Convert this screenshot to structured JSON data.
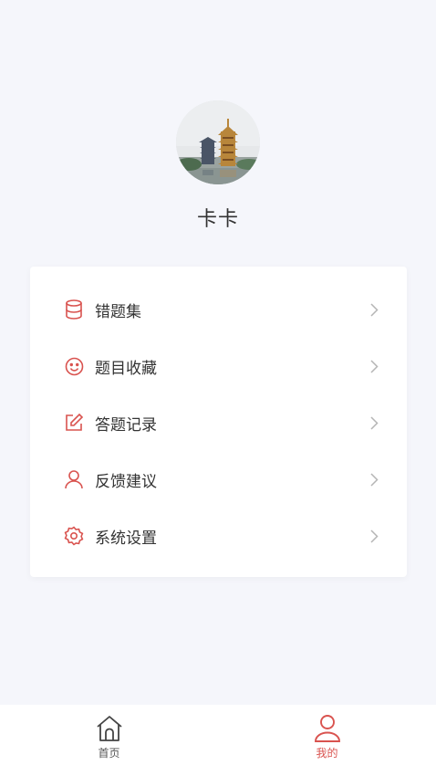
{
  "profile": {
    "username": "卡卡"
  },
  "menu": {
    "items": [
      {
        "label": "错题集",
        "icon": "database-icon"
      },
      {
        "label": "题目收藏",
        "icon": "smile-icon"
      },
      {
        "label": "答题记录",
        "icon": "edit-icon"
      },
      {
        "label": "反馈建议",
        "icon": "user-icon"
      },
      {
        "label": "系统设置",
        "icon": "gear-icon"
      }
    ]
  },
  "tabbar": {
    "tabs": [
      {
        "label": "首页",
        "icon": "home-icon",
        "active": false
      },
      {
        "label": "我的",
        "icon": "user-icon",
        "active": true
      }
    ]
  },
  "colors": {
    "accent": "#d9534f",
    "background": "#f5f6fb",
    "text": "#333333",
    "inactive_tab": "#555555",
    "chevron": "#b5b5b5"
  }
}
